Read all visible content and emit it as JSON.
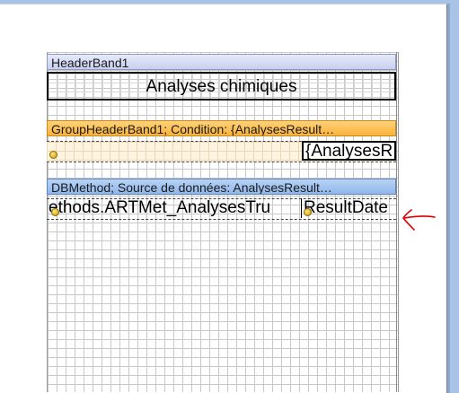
{
  "bands": {
    "header_label": "HeaderBand1",
    "group_label": "GroupHeaderBand1;  Condition: {AnalysesResult…",
    "data_label": "DBMethod; Source de données: AnalysesResult…"
  },
  "fields": {
    "title": "Analyses chimiques",
    "group_field": "{AnalysesR",
    "data_field_1": "ethods.ARTMet_AnalysesTru",
    "data_field_2": "ResultDate"
  },
  "colors": {
    "header_band": "#c8d0ef",
    "group_band": "#f8b23a",
    "data_band": "#8fb6eb",
    "annotation": "#e00000"
  },
  "icons": {
    "annotation": "red-arrow-icon",
    "field_marker": "bookmark-marker-icon"
  }
}
